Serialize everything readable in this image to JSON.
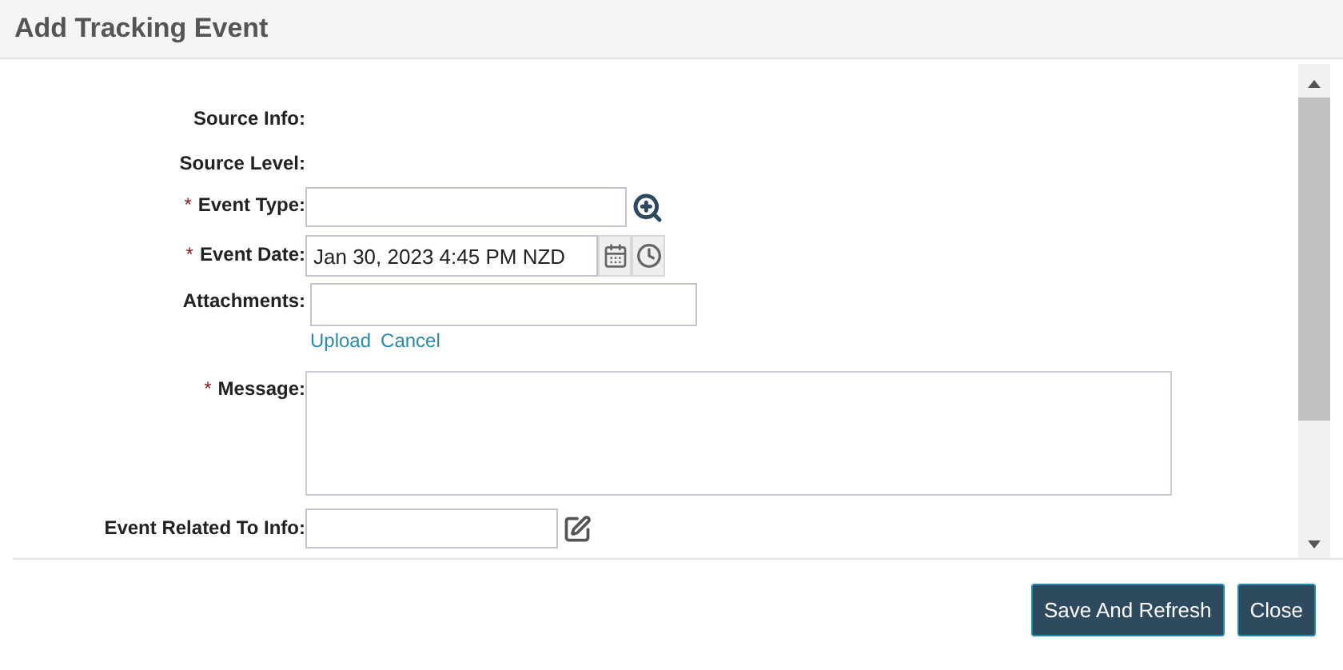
{
  "dialog": {
    "title": "Add Tracking Event"
  },
  "fields": [
    {
      "kind": "readonly",
      "label": "Source Info:"
    },
    {
      "kind": "readonly",
      "label": "Source Level:"
    },
    {
      "kind": "lookup",
      "label": "Event Type:",
      "marker": "*"
    },
    {
      "kind": "datetime",
      "label": "Event Date:",
      "marker": "*",
      "value": "Jan 30, 2023 4:45 PM NZD"
    },
    {
      "kind": "upload",
      "label": "Attachments:",
      "links": [
        "Upload",
        "Cancel"
      ]
    },
    {
      "kind": "textarea",
      "label": "Message:",
      "marker": "*"
    },
    {
      "kind": "related",
      "label": "Event Related To Info:"
    }
  ],
  "buttons": [
    "Save And Refresh",
    "Close"
  ]
}
